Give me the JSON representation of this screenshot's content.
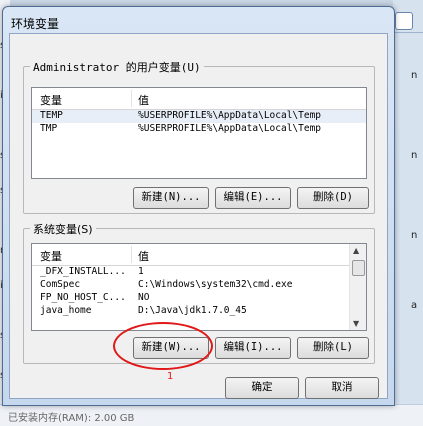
{
  "background": {
    "left_glyphs": [
      "s",
      "i",
      "s",
      "s",
      "r",
      "i",
      "s",
      "s"
    ],
    "right_glyphs": [
      "n",
      "n",
      "n",
      "a"
    ],
    "bottom_text": "已安装内存(RAM):          2.00 GB"
  },
  "dialog": {
    "title": "环境变量",
    "user_group": {
      "legend": "Administrator 的用户变量(U)",
      "headers": [
        "变量",
        "值"
      ],
      "rows": [
        {
          "name": "TEMP",
          "value": "%USERPROFILE%\\AppData\\Local\\Temp"
        },
        {
          "name": "TMP",
          "value": "%USERPROFILE%\\AppData\\Local\\Temp"
        }
      ],
      "buttons": {
        "new": "新建(N)...",
        "edit": "编辑(E)...",
        "delete": "删除(D)"
      }
    },
    "system_group": {
      "legend": "系统变量(S)",
      "headers": [
        "变量",
        "值"
      ],
      "rows": [
        {
          "name": "_DFX_INSTALL...",
          "value": "1"
        },
        {
          "name": "ComSpec",
          "value": "C:\\Windows\\system32\\cmd.exe"
        },
        {
          "name": "FP_NO_HOST_C...",
          "value": "NO"
        },
        {
          "name": "java_home",
          "value": "D:\\Java\\jdk1.7.0_45"
        }
      ],
      "buttons": {
        "new": "新建(W)...",
        "edit": "编辑(I)...",
        "delete": "删除(L)"
      }
    },
    "annotation": "1",
    "ok": "确定",
    "cancel": "取消"
  },
  "colors": {
    "annotation_red": "#e01818",
    "window_border": "#4f6c93"
  }
}
